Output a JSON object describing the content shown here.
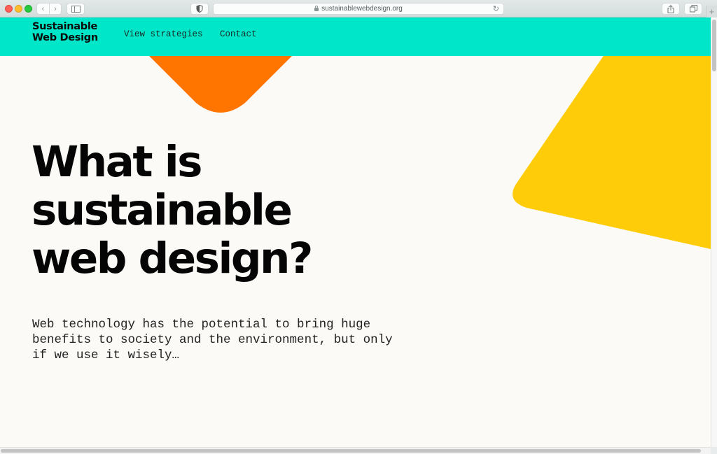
{
  "browser": {
    "url": "sustainablewebdesign.org",
    "icons": {
      "close": "window-close-dot",
      "minimize": "window-minimize-dot",
      "maximize": "window-maximize-dot",
      "back": "‹",
      "forward": "›",
      "sidebar": "▯",
      "shield": "◐",
      "reload": "↻",
      "share": "⇪",
      "tabs": "⧉",
      "new_tab": "+"
    }
  },
  "site": {
    "logo_line1": "Sustainable",
    "logo_line2": "Web Design",
    "nav": [
      {
        "label": "View strategies"
      },
      {
        "label": "Contact"
      }
    ],
    "hero": {
      "title_lines": [
        "What is",
        "sustainable",
        "web design?"
      ],
      "lead": "Web technology has the potential to bring huge benefits to society and the environment, but only if we use it wisely…"
    }
  },
  "colors": {
    "header": "#00e6c8",
    "page_background": "#fbfaf6",
    "accent_orange": "#ff7500",
    "accent_yellow": "#ffcc0a",
    "text": "#050505"
  }
}
